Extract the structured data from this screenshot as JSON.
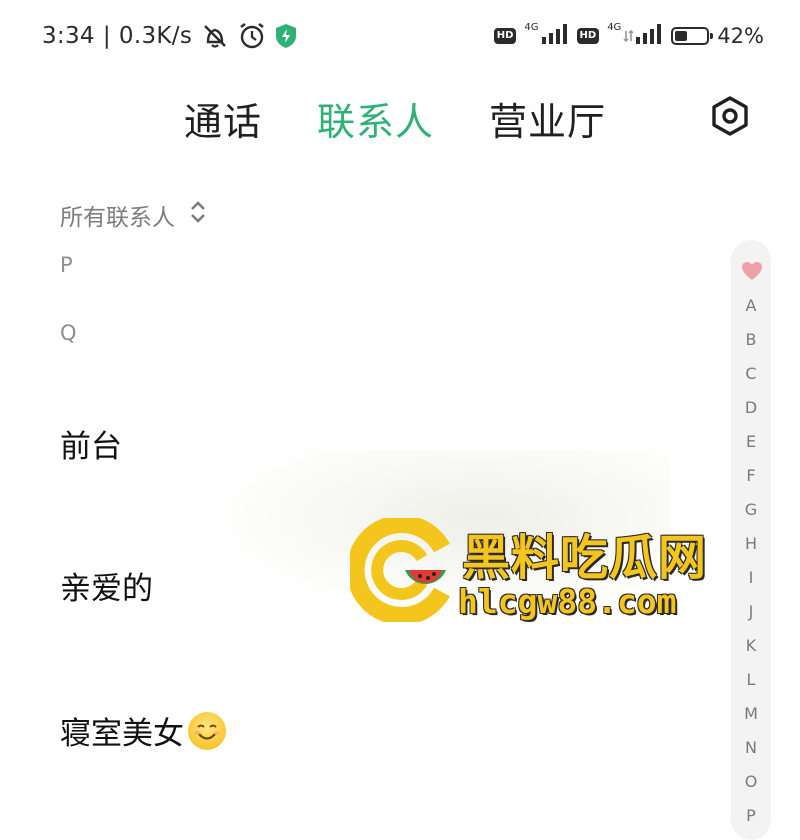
{
  "status_bar": {
    "time": "3:34",
    "separator": "|",
    "net_speed": "0.3K/s",
    "hd_label": "HD",
    "network_type": "4G",
    "battery_percent": "42%",
    "battery_level": 0.42,
    "icons": [
      "bell-muted-icon",
      "alarm-icon",
      "shield-icon",
      "signal-icon",
      "battery-icon"
    ]
  },
  "tabs": [
    {
      "label": "通话",
      "active": false
    },
    {
      "label": "联系人",
      "active": true
    },
    {
      "label": "营业厅",
      "active": false
    }
  ],
  "accent_color": "#2fb176",
  "filter": {
    "label": "所有联系人"
  },
  "sections": [
    {
      "letter": "P"
    },
    {
      "letter": "Q"
    }
  ],
  "contacts": [
    {
      "name": "前台"
    },
    {
      "name": "亲爱的"
    },
    {
      "name": "寝室美女"
    }
  ],
  "index_bar": {
    "letters": [
      "A",
      "B",
      "C",
      "D",
      "E",
      "F",
      "G",
      "H",
      "I",
      "J",
      "K",
      "L",
      "M",
      "N",
      "O",
      "P"
    ]
  },
  "watermark": {
    "title": "黑料吃瓜网",
    "url": "hlcgw88.com"
  }
}
